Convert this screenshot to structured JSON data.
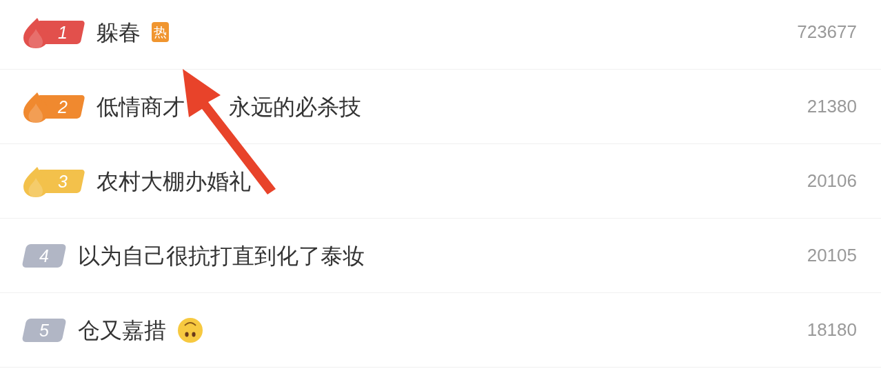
{
  "rows": [
    {
      "rank": "1",
      "kind": "flame",
      "color": "#e2504c",
      "title": "躲春",
      "tag": "热",
      "emoji": false,
      "count": "723677"
    },
    {
      "rank": "2",
      "kind": "flame",
      "color": "#f0892f",
      "title": "低情商才",
      "title_after_arrow": "永远的必杀技",
      "emoji": false,
      "count": "21380"
    },
    {
      "rank": "3",
      "kind": "flame",
      "color": "#f3c14b",
      "title": "农村大棚办婚礼",
      "emoji": false,
      "count": "20106"
    },
    {
      "rank": "4",
      "kind": "plain",
      "color": "#b1b6c5",
      "title": "以为自己很抗打直到化了泰妆",
      "emoji": false,
      "count": "20105"
    },
    {
      "rank": "5",
      "kind": "plain",
      "color": "#b1b6c5",
      "title": "仓又嘉措",
      "emoji": true,
      "count": "18180"
    }
  ],
  "annotations": [
    {
      "kind": "arrow"
    }
  ]
}
